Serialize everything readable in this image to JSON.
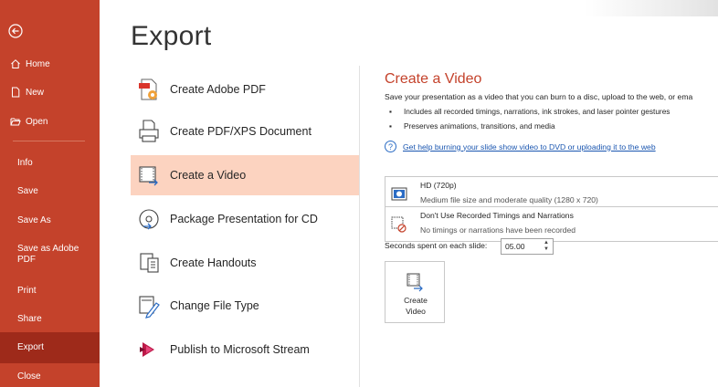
{
  "sidebar": {
    "back_icon": "back-arrow-icon",
    "top_items": [
      {
        "label": "Home",
        "icon": "home-icon"
      },
      {
        "label": "New",
        "icon": "new-document-icon"
      },
      {
        "label": "Open",
        "icon": "folder-open-icon"
      }
    ],
    "items": [
      "Info",
      "Save",
      "Save As",
      "Save as Adobe PDF",
      "Print",
      "Share",
      "Export",
      "Close"
    ],
    "selected": "Export",
    "colors": {
      "bg": "#c4422b",
      "selected": "#9e2a1a"
    }
  },
  "main": {
    "title": "Export",
    "options": [
      {
        "label": "Create Adobe PDF",
        "icon": "adobe-pdf-icon"
      },
      {
        "label": "Create PDF/XPS Document",
        "icon": "pdf-xps-icon"
      },
      {
        "label": "Create a Video",
        "icon": "video-icon"
      },
      {
        "label": "Package Presentation for CD",
        "icon": "cd-package-icon"
      },
      {
        "label": "Create Handouts",
        "icon": "handouts-icon"
      },
      {
        "label": "Change File Type",
        "icon": "change-file-type-icon"
      },
      {
        "label": "Publish to Microsoft Stream",
        "icon": "microsoft-stream-icon"
      }
    ],
    "selected": "Create a Video"
  },
  "panel": {
    "title": "Create a Video",
    "description": "Save your presentation as a video that you can burn to a disc, upload to the web, or ema",
    "bullets": [
      "Includes all recorded timings, narrations, ink strokes, and laser pointer gestures",
      "Preserves animations, transitions, and media"
    ],
    "help_link": "Get help burning your slide show video to DVD or uploading it to the web",
    "quality": {
      "label": "HD (720p)",
      "detail": "Medium file size and moderate quality (1280 x 720)"
    },
    "timings": {
      "label": "Don't Use Recorded Timings and Narrations",
      "detail": "No timings or narrations have been recorded"
    },
    "seconds_label": "Seconds spent on each slide:",
    "seconds_value": "05.00",
    "create_button": {
      "line1": "Create",
      "line2": "Video"
    }
  }
}
